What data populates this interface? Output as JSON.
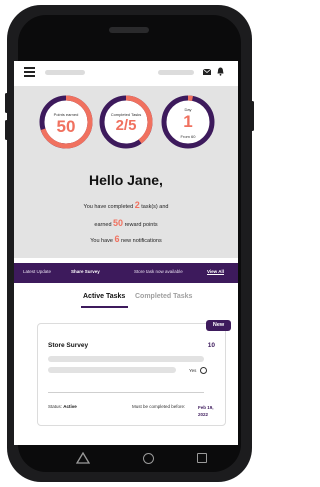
{
  "stats": [
    {
      "label": "Points earned",
      "value": "50",
      "sub": "",
      "progress": 0.7
    },
    {
      "label": "Completed Tasks",
      "value": "2/5",
      "sub": "",
      "progress": 0.4
    },
    {
      "label": "Day",
      "value": "1",
      "sub": "From 60",
      "progress": 0.03
    }
  ],
  "greeting": {
    "hello": "Hello Jane,",
    "line1_pre": "You have completed ",
    "line1_num": "2",
    "line1_post": " task(s) and",
    "line2_pre": "earned ",
    "line2_num": "50",
    "line2_post": " reward points",
    "line3_pre": "You have ",
    "line3_num": "6",
    "line3_post": " new notifications"
  },
  "ticker": {
    "latest": "Latest Update",
    "share": "Share Survey",
    "available": "Store task now available",
    "view_all": "View All"
  },
  "tabs": {
    "active": "Active Tasks",
    "completed": "Completed Tasks"
  },
  "task_card": {
    "badge": "New",
    "title": "Store Survey",
    "count": "10",
    "yes_label": "Yes",
    "status_label": "Status:",
    "status_value": "Active",
    "due_label": "Must be completed before:",
    "due_date": "Feb 19, 2022"
  },
  "colors": {
    "accent": "#f0715f",
    "brand": "#3d1a5c"
  },
  "icons": {
    "menu": "hamburger-icon",
    "mail": "mail-icon",
    "notifications": "bell-icon",
    "back": "triangle-back-icon",
    "home": "circle-home-icon",
    "recents": "square-recents-icon"
  }
}
